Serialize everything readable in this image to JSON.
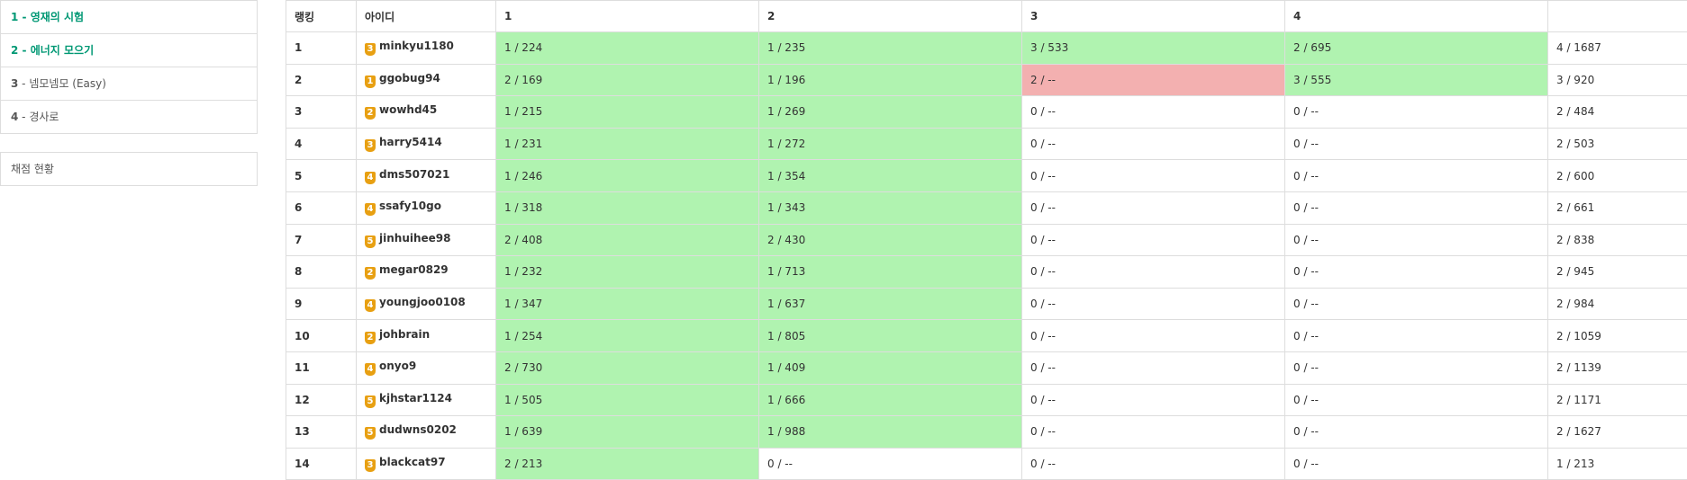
{
  "sidebar": {
    "problems": [
      {
        "num": "1",
        "title": " - 영재의 시험",
        "solved": true
      },
      {
        "num": "2",
        "title": " - 에너지 모으기",
        "solved": true
      },
      {
        "num": "3",
        "title": " - 넴모넴모 (Easy)",
        "solved": false
      },
      {
        "num": "4",
        "title": " - 경사로",
        "solved": false
      }
    ],
    "status_label": "채점 현황"
  },
  "table": {
    "headers": [
      "랭킹",
      "아이디",
      "1",
      "2",
      "3",
      "4",
      ""
    ],
    "rows": [
      {
        "rank": "1",
        "tier": "3",
        "user": "minkyu1180",
        "p": [
          "1 / 224",
          "1 / 235",
          "3 / 533",
          "2 / 695"
        ],
        "s": [
          "ac",
          "ac",
          "ac",
          "ac"
        ],
        "total": "4 / 1687"
      },
      {
        "rank": "2",
        "tier": "1",
        "user": "ggobug94",
        "p": [
          "2 / 169",
          "1 / 196",
          "2 / --",
          "3 / 555"
        ],
        "s": [
          "ac",
          "ac",
          "wa",
          "ac"
        ],
        "total": "3 / 920"
      },
      {
        "rank": "3",
        "tier": "2",
        "user": "wowhd45",
        "p": [
          "1 / 215",
          "1 / 269",
          "0 / --",
          "0 / --"
        ],
        "s": [
          "ac",
          "ac",
          "none",
          "none"
        ],
        "total": "2 / 484"
      },
      {
        "rank": "4",
        "tier": "3",
        "user": "harry5414",
        "p": [
          "1 / 231",
          "1 / 272",
          "0 / --",
          "0 / --"
        ],
        "s": [
          "ac",
          "ac",
          "none",
          "none"
        ],
        "total": "2 / 503"
      },
      {
        "rank": "5",
        "tier": "4",
        "user": "dms507021",
        "p": [
          "1 / 246",
          "1 / 354",
          "0 / --",
          "0 / --"
        ],
        "s": [
          "ac",
          "ac",
          "none",
          "none"
        ],
        "total": "2 / 600"
      },
      {
        "rank": "6",
        "tier": "4",
        "user": "ssafy10go",
        "p": [
          "1 / 318",
          "1 / 343",
          "0 / --",
          "0 / --"
        ],
        "s": [
          "ac",
          "ac",
          "none",
          "none"
        ],
        "total": "2 / 661"
      },
      {
        "rank": "7",
        "tier": "5",
        "user": "jinhuihee98",
        "p": [
          "2 / 408",
          "2 / 430",
          "0 / --",
          "0 / --"
        ],
        "s": [
          "ac",
          "ac",
          "none",
          "none"
        ],
        "total": "2 / 838"
      },
      {
        "rank": "8",
        "tier": "2",
        "user": "megar0829",
        "p": [
          "1 / 232",
          "1 / 713",
          "0 / --",
          "0 / --"
        ],
        "s": [
          "ac",
          "ac",
          "none",
          "none"
        ],
        "total": "2 / 945"
      },
      {
        "rank": "9",
        "tier": "4",
        "user": "youngjoo0108",
        "p": [
          "1 / 347",
          "1 / 637",
          "0 / --",
          "0 / --"
        ],
        "s": [
          "ac",
          "ac",
          "none",
          "none"
        ],
        "total": "2 / 984"
      },
      {
        "rank": "10",
        "tier": "2",
        "user": "johbrain",
        "p": [
          "1 / 254",
          "1 / 805",
          "0 / --",
          "0 / --"
        ],
        "s": [
          "ac",
          "ac",
          "none",
          "none"
        ],
        "total": "2 / 1059"
      },
      {
        "rank": "11",
        "tier": "4",
        "user": "onyo9",
        "p": [
          "2 / 730",
          "1 / 409",
          "0 / --",
          "0 / --"
        ],
        "s": [
          "ac",
          "ac",
          "none",
          "none"
        ],
        "total": "2 / 1139"
      },
      {
        "rank": "12",
        "tier": "5",
        "user": "kjhstar1124",
        "p": [
          "1 / 505",
          "1 / 666",
          "0 / --",
          "0 / --"
        ],
        "s": [
          "ac",
          "ac",
          "none",
          "none"
        ],
        "total": "2 / 1171"
      },
      {
        "rank": "13",
        "tier": "5",
        "user": "dudwns0202",
        "p": [
          "1 / 639",
          "1 / 988",
          "0 / --",
          "0 / --"
        ],
        "s": [
          "ac",
          "ac",
          "none",
          "none"
        ],
        "total": "2 / 1627"
      },
      {
        "rank": "14",
        "tier": "3",
        "user": "blackcat97",
        "p": [
          "2 / 213",
          "0 / --",
          "0 / --",
          "0 / --"
        ],
        "s": [
          "ac",
          "none",
          "none",
          "none"
        ],
        "total": "1 / 213"
      }
    ]
  },
  "colors": {
    "solved_text": "#009874",
    "accepted_cell": "#b0f3b0",
    "wrong_cell": "#f3b0b0",
    "tier_badge": "#e8a012"
  }
}
